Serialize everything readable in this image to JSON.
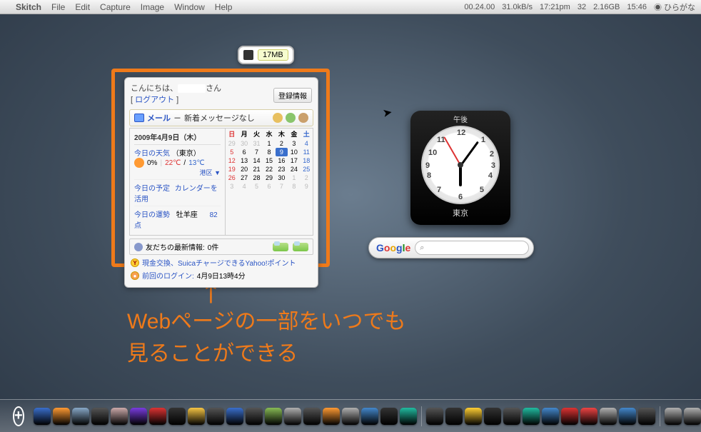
{
  "menubar": {
    "app": "Skitch",
    "items": [
      "File",
      "Edit",
      "Capture",
      "Image",
      "Window",
      "Help"
    ],
    "status_time_left": "00.24.00",
    "net_speed": "31.0kB/s",
    "clock": "17:21pm",
    "cpu": "32",
    "free": "2.16GB",
    "clock2": "15:46",
    "ime": "ひらがな"
  },
  "memwidget": {
    "label": "17MB"
  },
  "webclip": {
    "greeting": "こんにちは、",
    "name_suffix": "さん",
    "logout": "ログアウト",
    "register_btn": "登録情報",
    "mail_label": "メール",
    "mail_sep": "－",
    "mail_text": "新着メッセージなし",
    "today_date": "2009年4月9日（木）",
    "weather_label": "今日の天気",
    "weather_city": "（東京）",
    "precip": "0%",
    "temp_hi": "22℃",
    "temp_lo": "13℃",
    "ward": "港区",
    "ward_arrow": "▼",
    "plan_label": "今日の予定",
    "plan_link": "カレンダーを活用",
    "fortune_label": "今日の運勢",
    "fortune_sign": "牡羊座",
    "fortune_score": "82点",
    "cal_dow": [
      "日",
      "月",
      "火",
      "水",
      "木",
      "金",
      "土"
    ],
    "cal_weeks": [
      [
        {
          "d": 29,
          "o": true,
          "sun": true
        },
        {
          "d": 30,
          "o": true
        },
        {
          "d": 31,
          "o": true
        },
        {
          "d": 1
        },
        {
          "d": 2
        },
        {
          "d": 3
        },
        {
          "d": 4,
          "sat": true
        }
      ],
      [
        {
          "d": 5,
          "sun": true
        },
        {
          "d": 6
        },
        {
          "d": 7
        },
        {
          "d": 8
        },
        {
          "d": 9,
          "today": true
        },
        {
          "d": 10
        },
        {
          "d": 11,
          "sat": true
        }
      ],
      [
        {
          "d": 12,
          "sun": true
        },
        {
          "d": 13
        },
        {
          "d": 14
        },
        {
          "d": 15
        },
        {
          "d": 16
        },
        {
          "d": 17
        },
        {
          "d": 18,
          "sat": true
        }
      ],
      [
        {
          "d": 19,
          "sun": true
        },
        {
          "d": 20
        },
        {
          "d": 21
        },
        {
          "d": 22
        },
        {
          "d": 23
        },
        {
          "d": 24
        },
        {
          "d": 25,
          "sat": true
        }
      ],
      [
        {
          "d": 26,
          "sun": true
        },
        {
          "d": 27
        },
        {
          "d": 28
        },
        {
          "d": 29
        },
        {
          "d": 30
        },
        {
          "d": 1,
          "o": true
        },
        {
          "d": 2,
          "o": true,
          "sat": true
        }
      ],
      [
        {
          "d": 3,
          "o": true,
          "sun": true
        },
        {
          "d": 4,
          "o": true
        },
        {
          "d": 5,
          "o": true
        },
        {
          "d": 6,
          "o": true
        },
        {
          "d": 7,
          "o": true
        },
        {
          "d": 8,
          "o": true
        },
        {
          "d": 9,
          "o": true,
          "sat": true
        }
      ]
    ],
    "friends_label": "友だちの最新情報:",
    "friends_count": "0件",
    "yahoo_line": "現金交換、SuicaチャージできるYahoo!ポイント",
    "login_prefix": "前回のログイン:",
    "login_time": "4月9日13時4分"
  },
  "clock": {
    "ampm": "午後",
    "city": "東京",
    "hour_angle": 180,
    "minute_angle": 36,
    "second_angle": -30
  },
  "google": {
    "logo": "Google",
    "magnifier": "⌕"
  },
  "annotation": {
    "line1": "Webページの一部をいつでも",
    "line2": "見ることができる"
  },
  "dock_colors": [
    "#3a6fcc",
    "#ff9a33",
    "#88a8c8",
    "#555",
    "#caa",
    "#7a3ce0",
    "#d33",
    "#333",
    "#f6c544",
    "#555",
    "#3a6fcc",
    "#555",
    "#88bb55",
    "#b0b0b0",
    "#555",
    "#ff9a33",
    "#b0b0b0",
    "#4488cc",
    "#333",
    "#21bba0",
    "#555",
    "#333",
    "#ffcf33",
    "#333",
    "#555",
    "#21bba0",
    "#4488cc",
    "#d33",
    "#e44",
    "#b0b0b0",
    "#4488cc",
    "#555",
    "#b0b0b0",
    "#b0b0b0",
    "#88bb55",
    "#b0b0b0",
    "#ffd",
    "#b0b0b0"
  ]
}
